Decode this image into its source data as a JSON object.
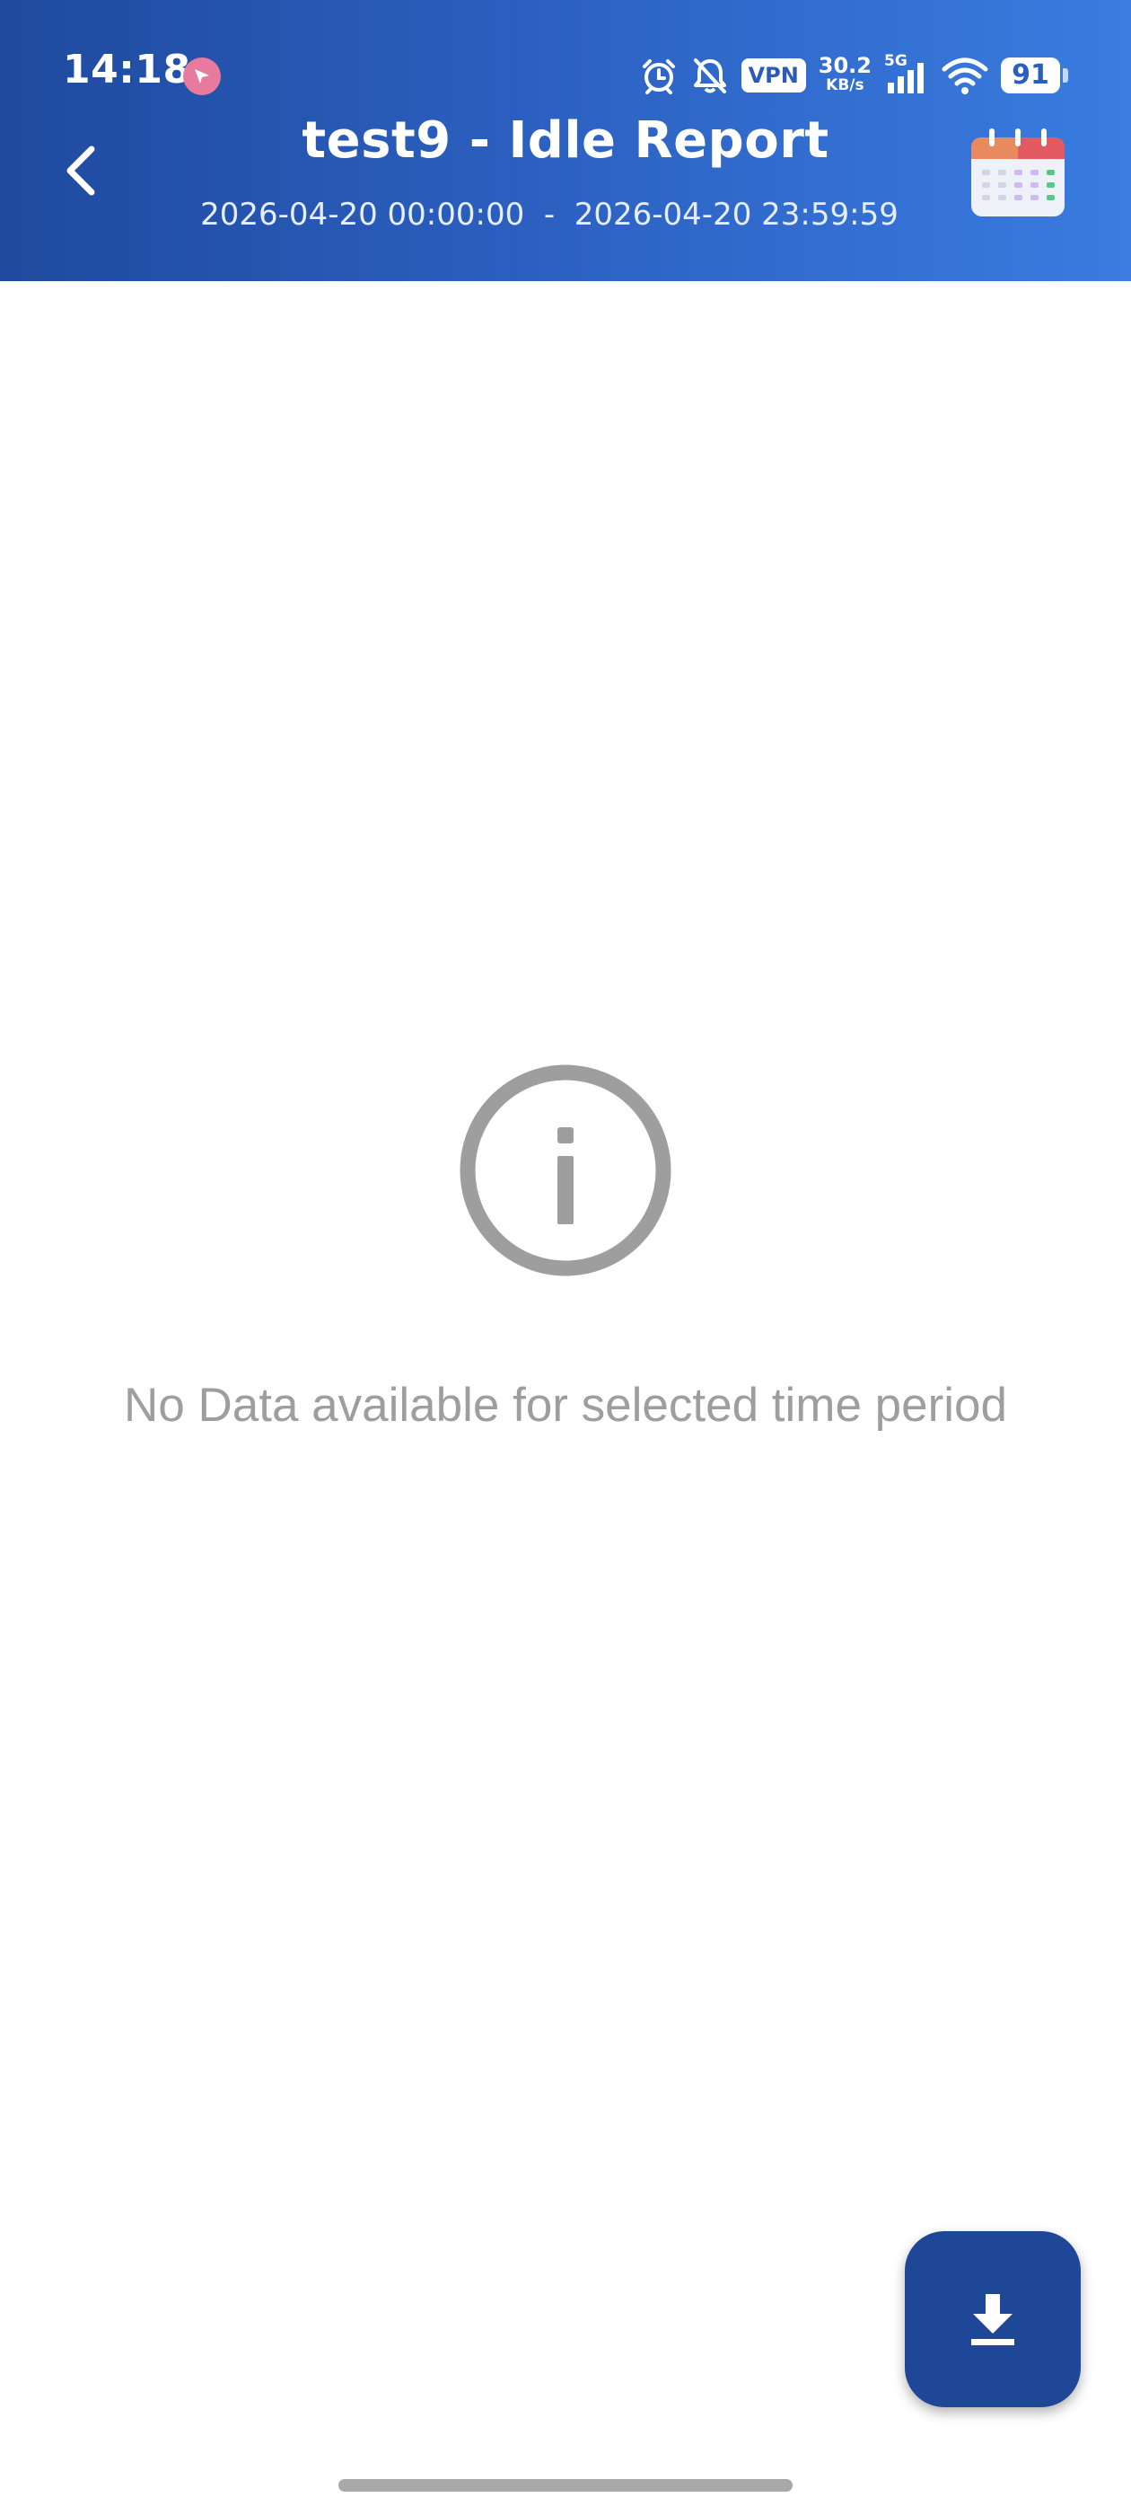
{
  "status_bar": {
    "time": "14:18",
    "vpn_label": "VPN",
    "net_speed_value": "30.2",
    "net_speed_unit": "KB/s",
    "network_type": "5G",
    "battery_level": "91",
    "icons": [
      "navigation-app-icon",
      "alarm-icon",
      "bell-off-icon",
      "vpn-icon",
      "signal-icon",
      "wifi-icon",
      "battery-icon"
    ]
  },
  "header": {
    "title": "test9 - Idle Report",
    "date_range": "2026-04-20 00:00:00  -  2026-04-20 23:59:59",
    "back_icon": "chevron-left-icon",
    "calendar_icon": "calendar-icon"
  },
  "empty_state": {
    "icon": "info-icon",
    "message": "No Data available for selected time period"
  },
  "fab": {
    "icon": "download-icon"
  },
  "colors": {
    "header_gradient_start": "#1f4a9e",
    "header_gradient_end": "#3a7ce0",
    "fab_background": "#1e4797",
    "empty_state_gray": "#9e9e9e"
  }
}
